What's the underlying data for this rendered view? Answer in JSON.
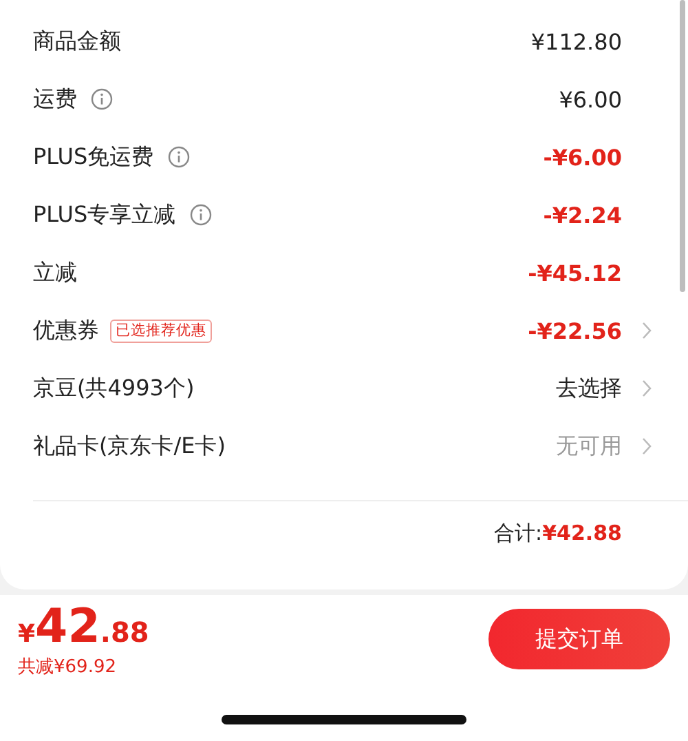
{
  "rows": [
    {
      "label": "商品金额",
      "info": false,
      "value": "¥112.80",
      "kind": "normal",
      "chevron": false
    },
    {
      "label": "运费",
      "info": true,
      "value": "¥6.00",
      "kind": "normal",
      "chevron": false
    },
    {
      "label": "PLUS免运费",
      "info": true,
      "value": "-¥6.00",
      "kind": "discount",
      "chevron": false
    },
    {
      "label": "PLUS专享立减",
      "info": true,
      "value": "-¥2.24",
      "kind": "discount",
      "chevron": false
    },
    {
      "label": "立减",
      "info": false,
      "value": "-¥45.12",
      "kind": "discount",
      "chevron": false
    },
    {
      "label": "优惠券",
      "info": false,
      "tag": "已选推荐优惠",
      "value": "-¥22.56",
      "kind": "discount",
      "chevron": true
    },
    {
      "label": "京豆(共4993个)",
      "info": false,
      "value": "去选择",
      "kind": "normal",
      "chevron": true
    },
    {
      "label": "礼品卡(京东卡/E卡)",
      "info": false,
      "value": "无可用",
      "kind": "unavailable",
      "chevron": true
    }
  ],
  "total": {
    "label": "合计:",
    "value": "¥42.88"
  },
  "footer": {
    "currency": "¥",
    "integer": "42",
    "decimal": ".88",
    "saving": "共减¥69.92",
    "submit": "提交订单"
  }
}
